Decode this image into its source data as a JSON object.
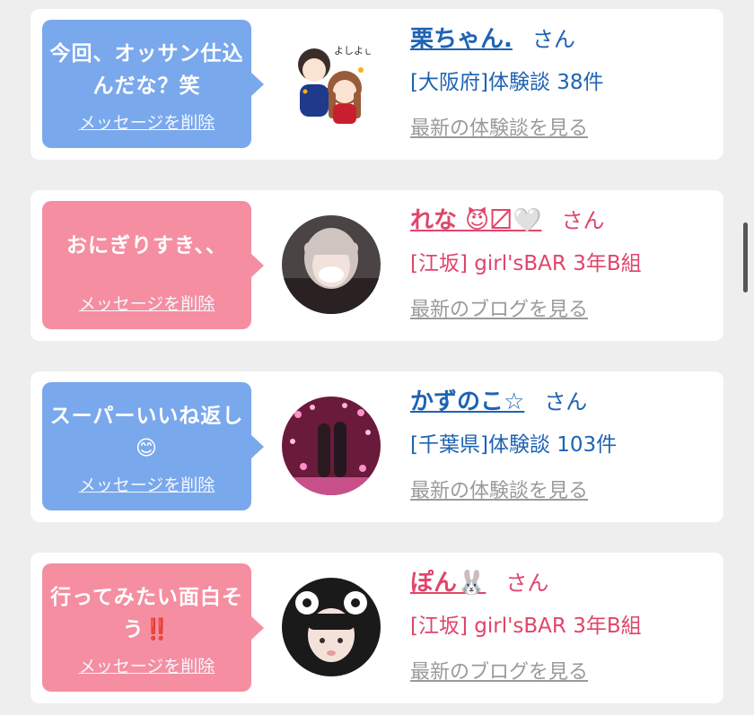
{
  "cards": [
    {
      "message": "今回、オッサン仕込んだな？笑",
      "delete_label": "メッセージを削除",
      "name": "栗ちゃん.",
      "suffix": "さん",
      "detail": "[大阪府]体験談 38件",
      "link": "最新の体験談を見る",
      "theme": "blue",
      "avatar": "illustration-couple",
      "avatar_text": "よしよし"
    },
    {
      "message": "おにぎりすき、、",
      "delete_label": "メッセージを削除",
      "name": "れな 😈〼🤍",
      "suffix": "さん",
      "detail": "[江坂] girl'sBAR 3年B組",
      "link": "最新のブログを見る",
      "theme": "pink",
      "avatar": "photo-girl"
    },
    {
      "message": "スーパーいいね返し😊",
      "delete_label": "メッセージを削除",
      "name": "かずのこ☆",
      "suffix": "さん",
      "detail": "[千葉県]体験談 103件",
      "link": "最新の体験談を見る",
      "theme": "blue",
      "avatar": "photo-couple-lights"
    },
    {
      "message": "行ってみたい面白そう‼️",
      "delete_label": "メッセージを削除",
      "name": "ぽん🐰",
      "suffix": "さん",
      "detail": "[江坂] girl'sBAR 3年B組",
      "link": "最新のブログを見る",
      "theme": "pink",
      "avatar": "photo-girl-ears"
    }
  ],
  "colors": {
    "blue_bubble": "#7aa8ec",
    "pink_bubble": "#f58ea1",
    "blue_text": "#1e63b3",
    "pink_text": "#e0456a",
    "link_gray": "#9a9a9a",
    "background": "#eeeeee"
  }
}
